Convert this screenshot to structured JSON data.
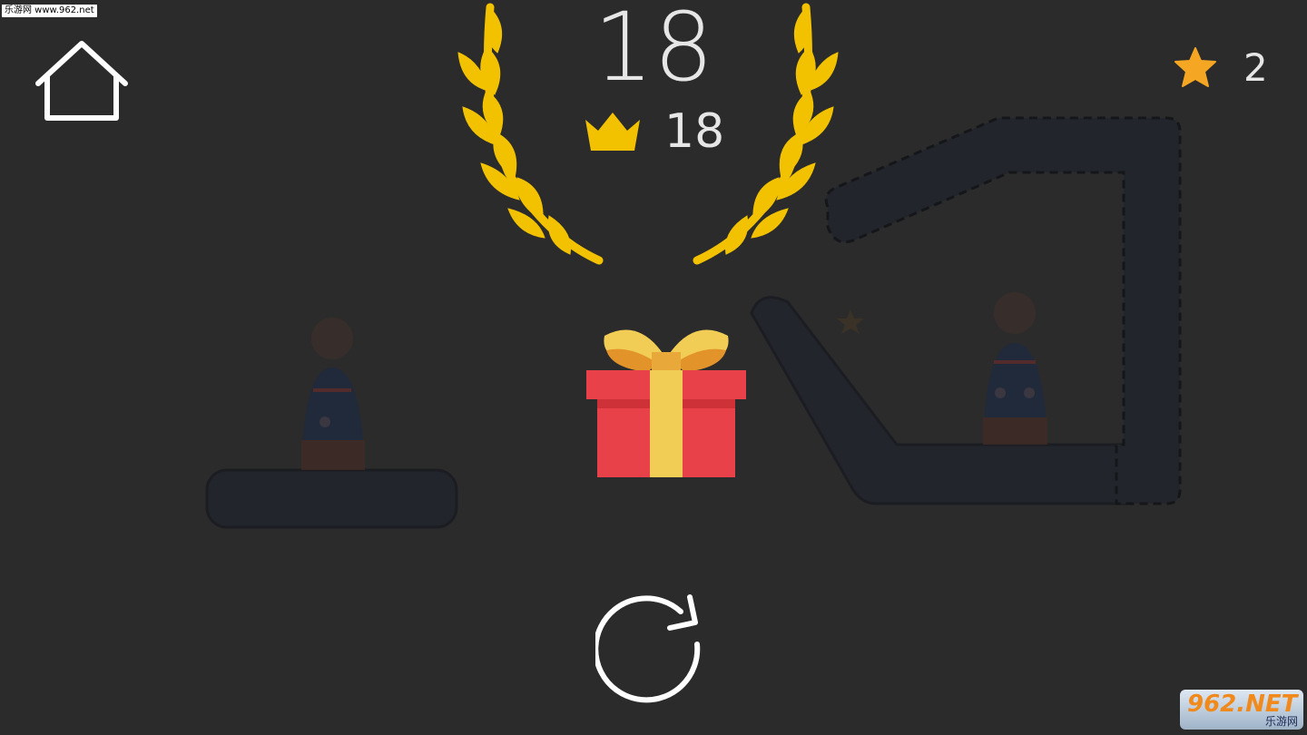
{
  "watermark": "乐游网 www.962.net",
  "score": "18",
  "best": {
    "value": "18",
    "icon": "crown-icon"
  },
  "stars": {
    "count": "2",
    "icon": "star-icon"
  },
  "home": {
    "icon": "home-icon"
  },
  "restart": {
    "icon": "restart-icon"
  },
  "gift": {
    "icon": "gift-icon"
  },
  "brand": {
    "main": "962.NET",
    "sub": "乐游网"
  },
  "colors": {
    "background": "#2b2b2b",
    "laurel": "#f2c200",
    "star": "#f5a623",
    "gift_red": "#e8414a",
    "gift_ribbon": "#f2cd55",
    "platform": "#22252b"
  }
}
